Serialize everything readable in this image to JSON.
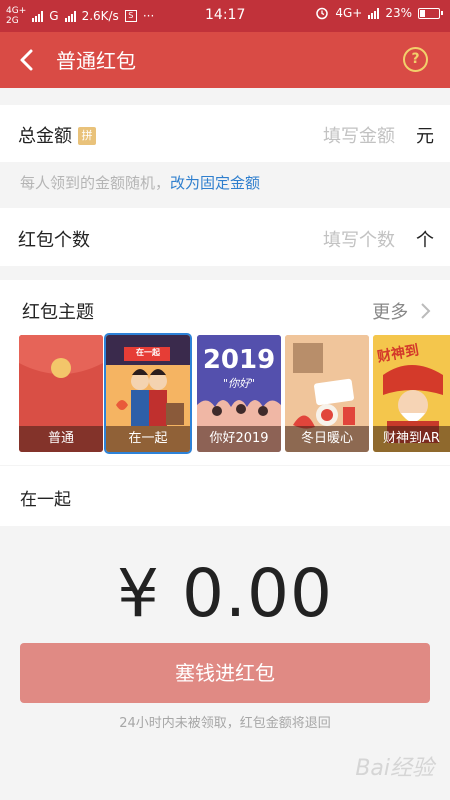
{
  "status_bar": {
    "network_top": "4G+",
    "network_bottom": "2G",
    "carrier_g": "G",
    "speed": "2.6K/s",
    "dots": "···",
    "time": "14:17",
    "right_network": "4G+",
    "battery_percent": "23%",
    "battery_level": 0.23
  },
  "title_bar": {
    "title": "普通红包",
    "help_symbol": "?"
  },
  "amount_row": {
    "label": "总金额",
    "badge": "拼",
    "placeholder": "填写金额",
    "unit": "元"
  },
  "hint": {
    "text": "每人领到的金额随机，",
    "link": "改为固定金额"
  },
  "count_row": {
    "label": "红包个数",
    "placeholder": "填写个数",
    "unit": "个"
  },
  "themes": {
    "label": "红包主题",
    "more": "更多",
    "items": [
      {
        "label": "普通"
      },
      {
        "label": "在一起",
        "title_text": "在一起"
      },
      {
        "label": "你好2019",
        "title_text": "2019",
        "subtitle_text": "\"你好\""
      },
      {
        "label": "冬日暖心"
      },
      {
        "label": "财神到AR",
        "title_text": "财神到"
      }
    ],
    "selected_label": "在一起"
  },
  "amount_display": "¥ 0.00",
  "submit_label": "塞钱进红包",
  "footer_note": "24小时内未被领取，红包金额将退回",
  "watermark": "Bai经验"
}
